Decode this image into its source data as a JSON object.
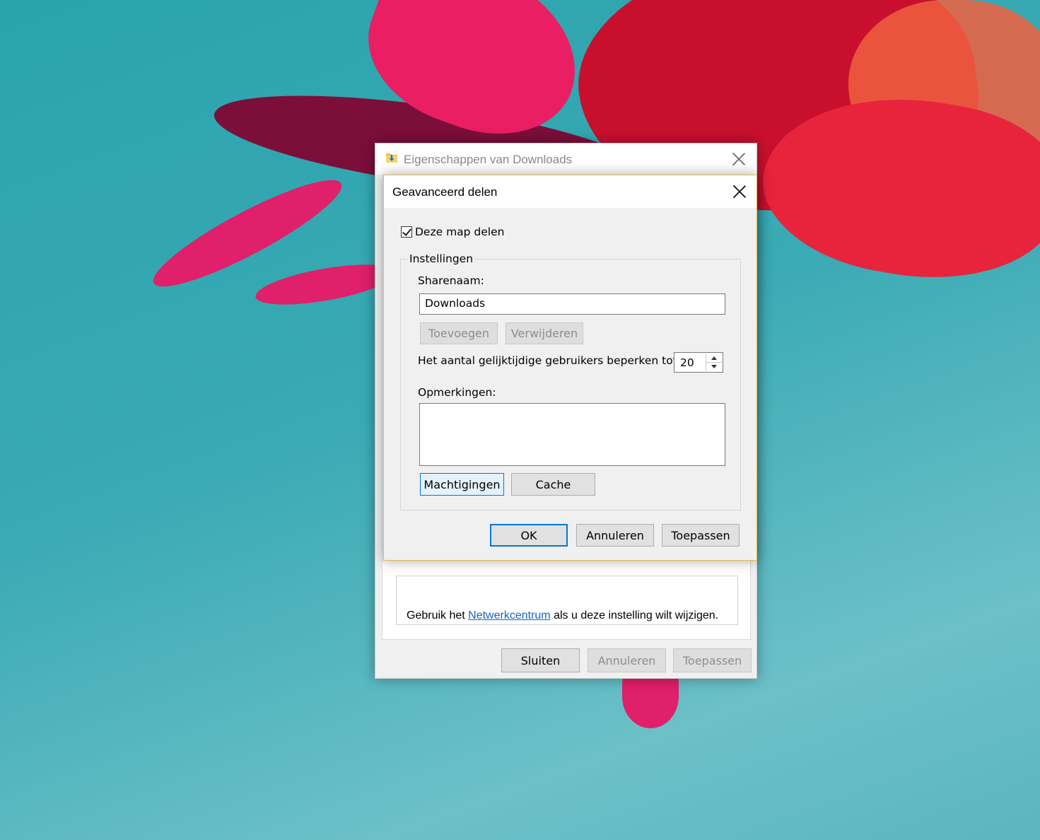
{
  "properties_window": {
    "title": "Eigenschappen van Downloads",
    "icon": "folder-download-icon",
    "network_text_before": "Gebruik het ",
    "network_link": "Netwerkcentrum",
    "network_text_after": " als u deze instelling wilt wijzigen.",
    "buttons": {
      "close_label": "Sluiten",
      "cancel_label": "Annuleren",
      "apply_label": "Toepassen"
    }
  },
  "advanced_sharing_dialog": {
    "title": "Geavanceerd delen",
    "share_checkbox_label": "Deze map delen",
    "share_checkbox_checked": true,
    "settings_group_label": "Instellingen",
    "share_name_label": "Sharenaam:",
    "share_name_value": "Downloads",
    "add_label": "Toevoegen",
    "remove_label": "Verwijderen",
    "user_limit_label": "Het aantal gelijktijdige gebruikers beperken tot:",
    "user_limit_value": "20",
    "comments_label": "Opmerkingen:",
    "comments_value": "",
    "permissions_label": "Machtigingen",
    "cache_label": "Cache",
    "ok_label": "OK",
    "cancel_label": "Annuleren",
    "apply_label": "Toepassen"
  },
  "colors": {
    "accent": "#0078d7",
    "link": "#1464c0",
    "dialog_border": "#e0b84a"
  }
}
